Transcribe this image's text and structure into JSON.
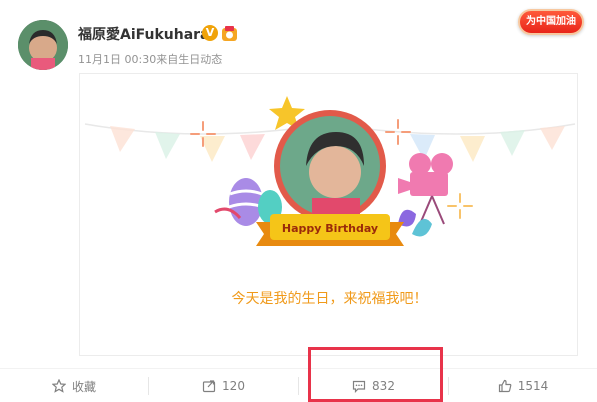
{
  "user": {
    "name": "福原愛AiFukuhara",
    "verified_badge": "V",
    "meta": "11月1日 00:30来自生日动态"
  },
  "cheer_badge": {
    "label": "为中国加油"
  },
  "card": {
    "banner_text": "Happy Birthday",
    "message": "今天是我的生日，来祝福我吧！"
  },
  "actions": {
    "favorite": {
      "label": "收藏",
      "icon": "star-outline-icon"
    },
    "repost": {
      "count": "120",
      "icon": "repost-icon"
    },
    "comment": {
      "count": "832",
      "icon": "comment-icon"
    },
    "like": {
      "count": "1514",
      "icon": "thumbs-up-icon"
    }
  },
  "colors": {
    "accent_orange": "#f09a1a",
    "highlight_red": "#e8334a",
    "banner_yellow": "#f5c518"
  }
}
